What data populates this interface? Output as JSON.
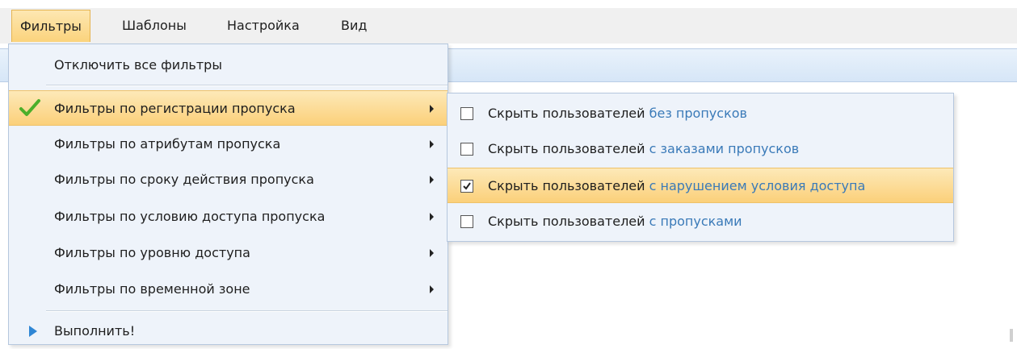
{
  "menubar": {
    "items": [
      {
        "label": "Фильтры",
        "active": true
      },
      {
        "label": "Шаблоны",
        "active": false
      },
      {
        "label": "Настройка",
        "active": false
      },
      {
        "label": "Вид",
        "active": false
      }
    ]
  },
  "filters_menu": {
    "disable_all": "Отключить все фильтры",
    "items": [
      {
        "label": "Фильтры по регистрации пропуска",
        "checked": true,
        "has_submenu": true,
        "highlighted": true
      },
      {
        "label": "Фильтры по атрибутам пропуска",
        "has_submenu": true
      },
      {
        "label": "Фильтры по сроку действия пропуска",
        "has_submenu": true
      },
      {
        "label": "Фильтры по условию доступа пропуска",
        "has_submenu": true
      },
      {
        "label": "Фильтры по уровню доступа",
        "has_submenu": true
      },
      {
        "label": "Фильтры по временной зоне",
        "has_submenu": true
      }
    ],
    "execute": "Выполнить!"
  },
  "submenu": {
    "items": [
      {
        "prefix": "Скрыть пользователей",
        "suffix": "без пропусков",
        "checked": false
      },
      {
        "prefix": "Скрыть пользователей",
        "suffix": "с заказами пропусков",
        "checked": false
      },
      {
        "prefix": "Скрыть пользователей",
        "suffix": "с нарушением условия доступа",
        "checked": true,
        "highlighted": true
      },
      {
        "prefix": "Скрыть пользователей",
        "suffix": "с пропусками",
        "checked": false
      }
    ]
  },
  "colors": {
    "highlight": "#fbd07a",
    "menu_background": "#eef3fa",
    "link_text": "#3a7ab8",
    "check_green": "#4caf2a",
    "play_blue": "#2f86d4"
  },
  "icons": {
    "active_filter": "check-icon",
    "execute": "play-icon"
  }
}
